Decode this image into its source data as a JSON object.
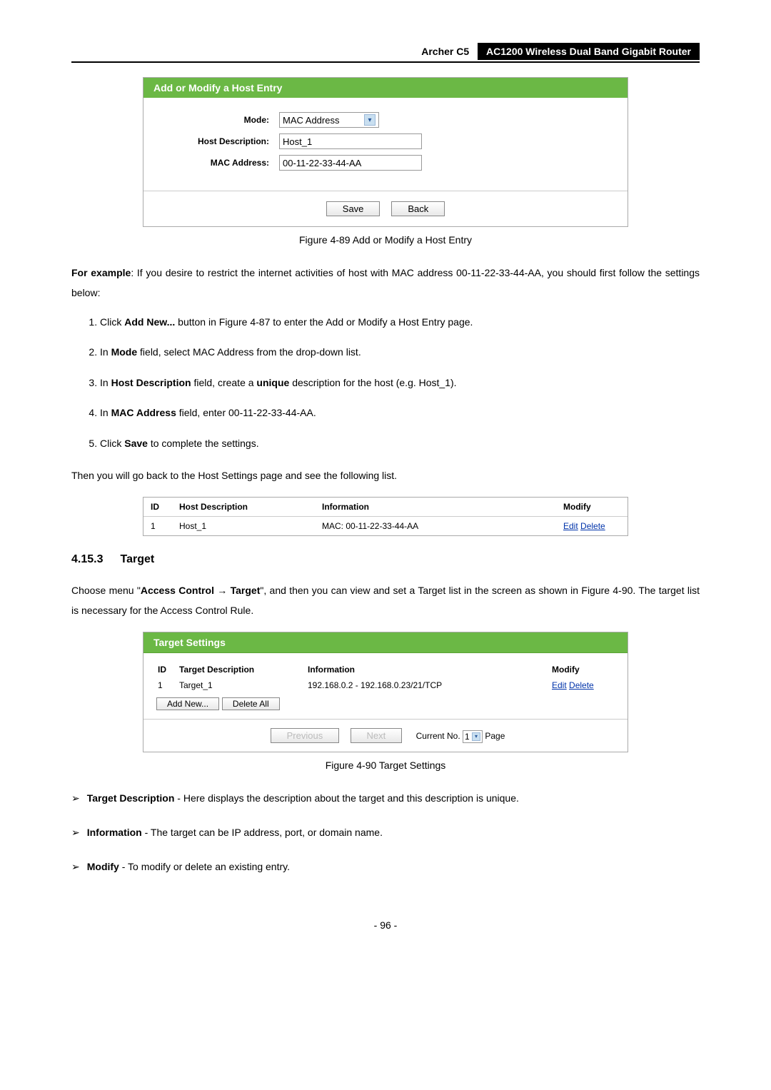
{
  "header": {
    "model": "Archer C5",
    "title": "AC1200 Wireless Dual Band Gigabit Router"
  },
  "figure89": {
    "box_title": "Add or Modify a Host Entry",
    "mode_label": "Mode:",
    "mode_value": "MAC Address",
    "host_desc_label": "Host Description:",
    "host_desc_value": "Host_1",
    "mac_label": "MAC Address:",
    "mac_value": "00-11-22-33-44-AA",
    "save_btn": "Save",
    "back_btn": "Back",
    "caption": "Figure 4-89 Add or Modify a Host Entry"
  },
  "example": {
    "intro_prefix": "For example",
    "intro_rest": ": If you desire to restrict the internet activities of host with MAC address 00-11-22-33-44-AA, you should first follow the settings below:",
    "steps": [
      {
        "pre": "Click ",
        "b1": "Add New...",
        "post": " button in Figure 4-87 to enter the Add or Modify a Host Entry page."
      },
      {
        "pre": "In ",
        "b1": "Mode",
        "post": " field, select MAC Address from the drop-down list."
      },
      {
        "pre": "In ",
        "b1": "Host Description",
        "mid": " field, create a ",
        "b2": "unique",
        "post": " description for the host (e.g. Host_1)."
      },
      {
        "pre": "In ",
        "b1": "MAC Address",
        "post": " field, enter 00-11-22-33-44-AA."
      },
      {
        "pre": "Click ",
        "b1": "Save",
        "post": " to complete the settings."
      }
    ],
    "outro": "Then you will go back to the Host Settings page and see the following list."
  },
  "host_table": {
    "h_id": "ID",
    "h_desc": "Host Description",
    "h_info": "Information",
    "h_modify": "Modify",
    "row": {
      "id": "1",
      "desc": "Host_1",
      "info": "MAC: 00-11-22-33-44-AA",
      "edit": "Edit",
      "delete": "Delete"
    }
  },
  "section": {
    "num": "4.15.3",
    "title": "Target",
    "desc_pre": "Choose menu \"",
    "desc_b1": "Access Control",
    "desc_arrow": " → ",
    "desc_b2": "Target",
    "desc_post": "\", and then you can view and set a Target list in the screen as shown in Figure 4-90. The target list is necessary for the Access Control Rule."
  },
  "figure90": {
    "box_title": "Target Settings",
    "h_id": "ID",
    "h_desc": "Target Description",
    "h_info": "Information",
    "h_modify": "Modify",
    "row": {
      "id": "1",
      "desc": "Target_1",
      "info": "192.168.0.2 - 192.168.0.23/21/TCP",
      "edit": "Edit",
      "delete": "Delete"
    },
    "add_new_btn": "Add New...",
    "delete_all_btn": "Delete All",
    "prev_btn": "Previous",
    "next_btn": "Next",
    "current_no_label": "Current No.",
    "page_value": "1",
    "page_label": "Page",
    "caption": "Figure 4-90 Target Settings"
  },
  "bullets": [
    {
      "b": "Target Description",
      "rest": " - Here displays the description about the target and this description is unique."
    },
    {
      "b": "Information",
      "rest": " - The target can be IP address, port, or domain name."
    },
    {
      "b": "Modify",
      "rest": " - To modify or delete an existing entry."
    }
  ],
  "page_number": "- 96 -"
}
